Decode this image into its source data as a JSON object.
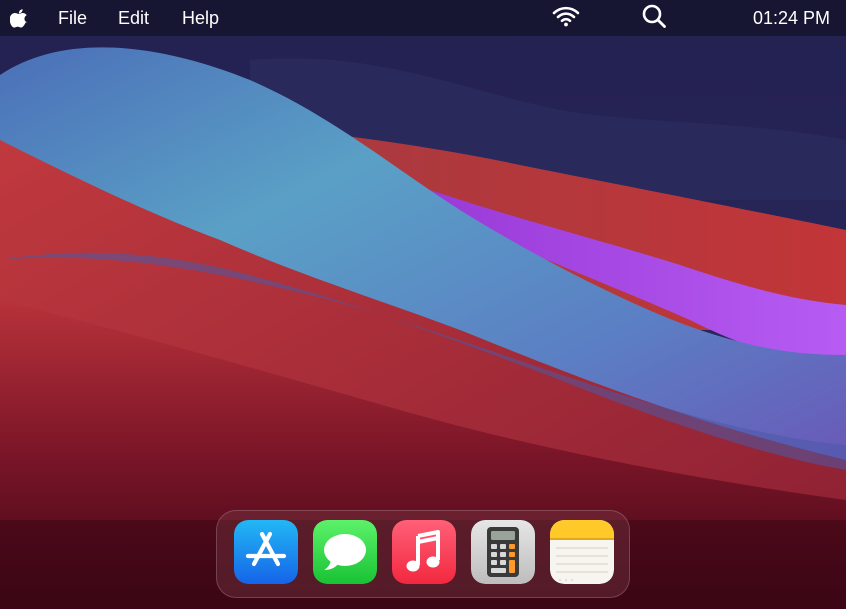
{
  "menubar": {
    "apple_icon": "apple-icon",
    "items": [
      {
        "label": "File"
      },
      {
        "label": "Edit"
      },
      {
        "label": "Help"
      }
    ],
    "status": {
      "wifi_icon": "wifi-icon",
      "search_icon": "search-icon",
      "clock": "01:24 PM"
    }
  },
  "dock": {
    "apps": [
      {
        "icon": "app-store-icon"
      },
      {
        "icon": "messages-icon"
      },
      {
        "icon": "music-icon"
      },
      {
        "icon": "calculator-icon"
      },
      {
        "icon": "notes-icon"
      }
    ]
  },
  "colors": {
    "wallpaper_top": "#2b2858",
    "wallpaper_blue": "#5aa2c8",
    "wallpaper_red": "#c2383b",
    "wallpaper_purple": "#b25cf0",
    "wallpaper_bottom": "#4d0c1c"
  }
}
